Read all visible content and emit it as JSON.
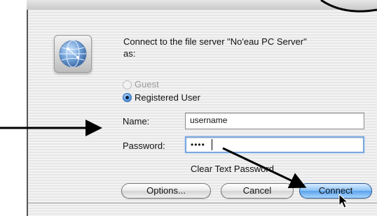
{
  "dialog": {
    "prompt_line1": "Connect to the file server \"No'eau PC Server\"",
    "prompt_line2": "as:",
    "guest_label": "Guest",
    "registered_label": "Registered User",
    "selected_option": "Registered User",
    "name_label": "Name:",
    "name_value": "username",
    "password_label": "Password:",
    "password_value": "••••",
    "clear_text_label": "Clear Text Password",
    "options_label": "Options...",
    "cancel_label": "Cancel",
    "connect_label": "Connect"
  },
  "icons": {
    "server": "network-server-globe-icon",
    "cursor": "mouse-pointer-icon"
  },
  "colors": {
    "default_button": "#5aa2ec",
    "focus_ring": "#7aa7e0",
    "annotation_arrows": "#000000"
  }
}
